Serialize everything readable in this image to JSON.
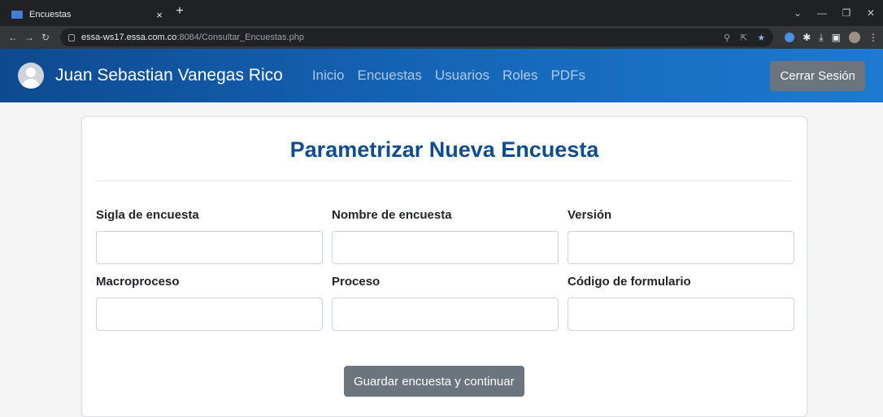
{
  "browser": {
    "tab_title": "Encuestas",
    "tab_close": "×",
    "new_tab": "+",
    "url_host": "essa-ws17.essa.com.co",
    "url_path": ":8084/Consultar_Encuestas.php",
    "win_minimize": "—",
    "win_restore": "❐",
    "win_close": "✕",
    "win_chevron": "⌄"
  },
  "navbar": {
    "user_name": "Juan Sebastian Vanegas Rico",
    "links": [
      "Inicio",
      "Encuestas",
      "Usuarios",
      "Roles",
      "PDFs"
    ],
    "logout_label": "Cerrar Sesión",
    "accent_start": "#0e4a8f",
    "accent_end": "#1d7ad0"
  },
  "form": {
    "title": "Parametrizar Nueva Encuesta",
    "fields": [
      {
        "label": "Sigla de encuesta",
        "value": ""
      },
      {
        "label": "Nombre de encuesta",
        "value": ""
      },
      {
        "label": "Versión",
        "value": ""
      },
      {
        "label": "Macroproceso",
        "value": ""
      },
      {
        "label": "Proceso",
        "value": ""
      },
      {
        "label": "Código de formulario",
        "value": ""
      }
    ],
    "submit_label": "Guardar encuesta y continuar"
  }
}
